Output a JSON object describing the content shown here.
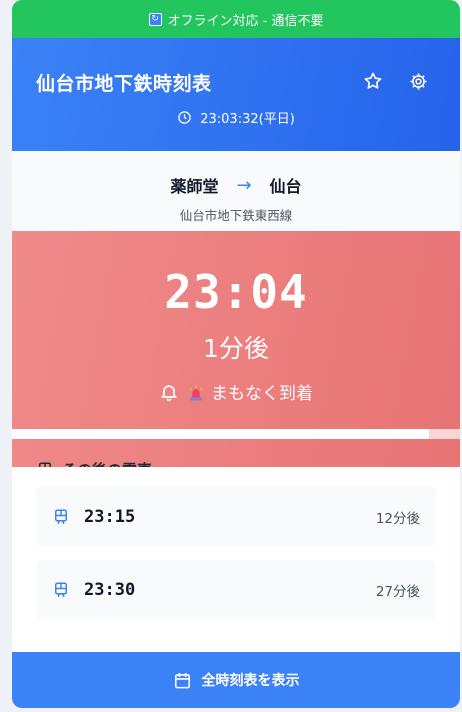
{
  "offline": {
    "label": "オフライン対応 - 通信不要"
  },
  "header": {
    "title": "仙台市地下鉄時刻表",
    "clock": "23:03:32(平日)"
  },
  "route": {
    "from": "薬師堂",
    "arrow": "→",
    "to": "仙台",
    "line": "仙台市地下鉄東西線"
  },
  "next_train": {
    "time": "23:04",
    "minutes_label": "1分後",
    "status": "まもなく到着",
    "progress": 0.93
  },
  "later": {
    "title": "その後の電車",
    "items": [
      {
        "time": "23:15",
        "after": "12分後"
      },
      {
        "time": "23:30",
        "after": "27分後"
      }
    ]
  },
  "footer": {
    "button_label": "全時刻表を表示"
  },
  "colors": {
    "offline_green": "#22c55e",
    "primary_blue": "#3b82f6",
    "next_red": "#ef7f7f"
  },
  "icons": [
    "refresh-icon",
    "star-icon",
    "gear-icon",
    "clock-icon",
    "bell-icon",
    "siren-icon",
    "train-icon",
    "calendar-icon"
  ]
}
